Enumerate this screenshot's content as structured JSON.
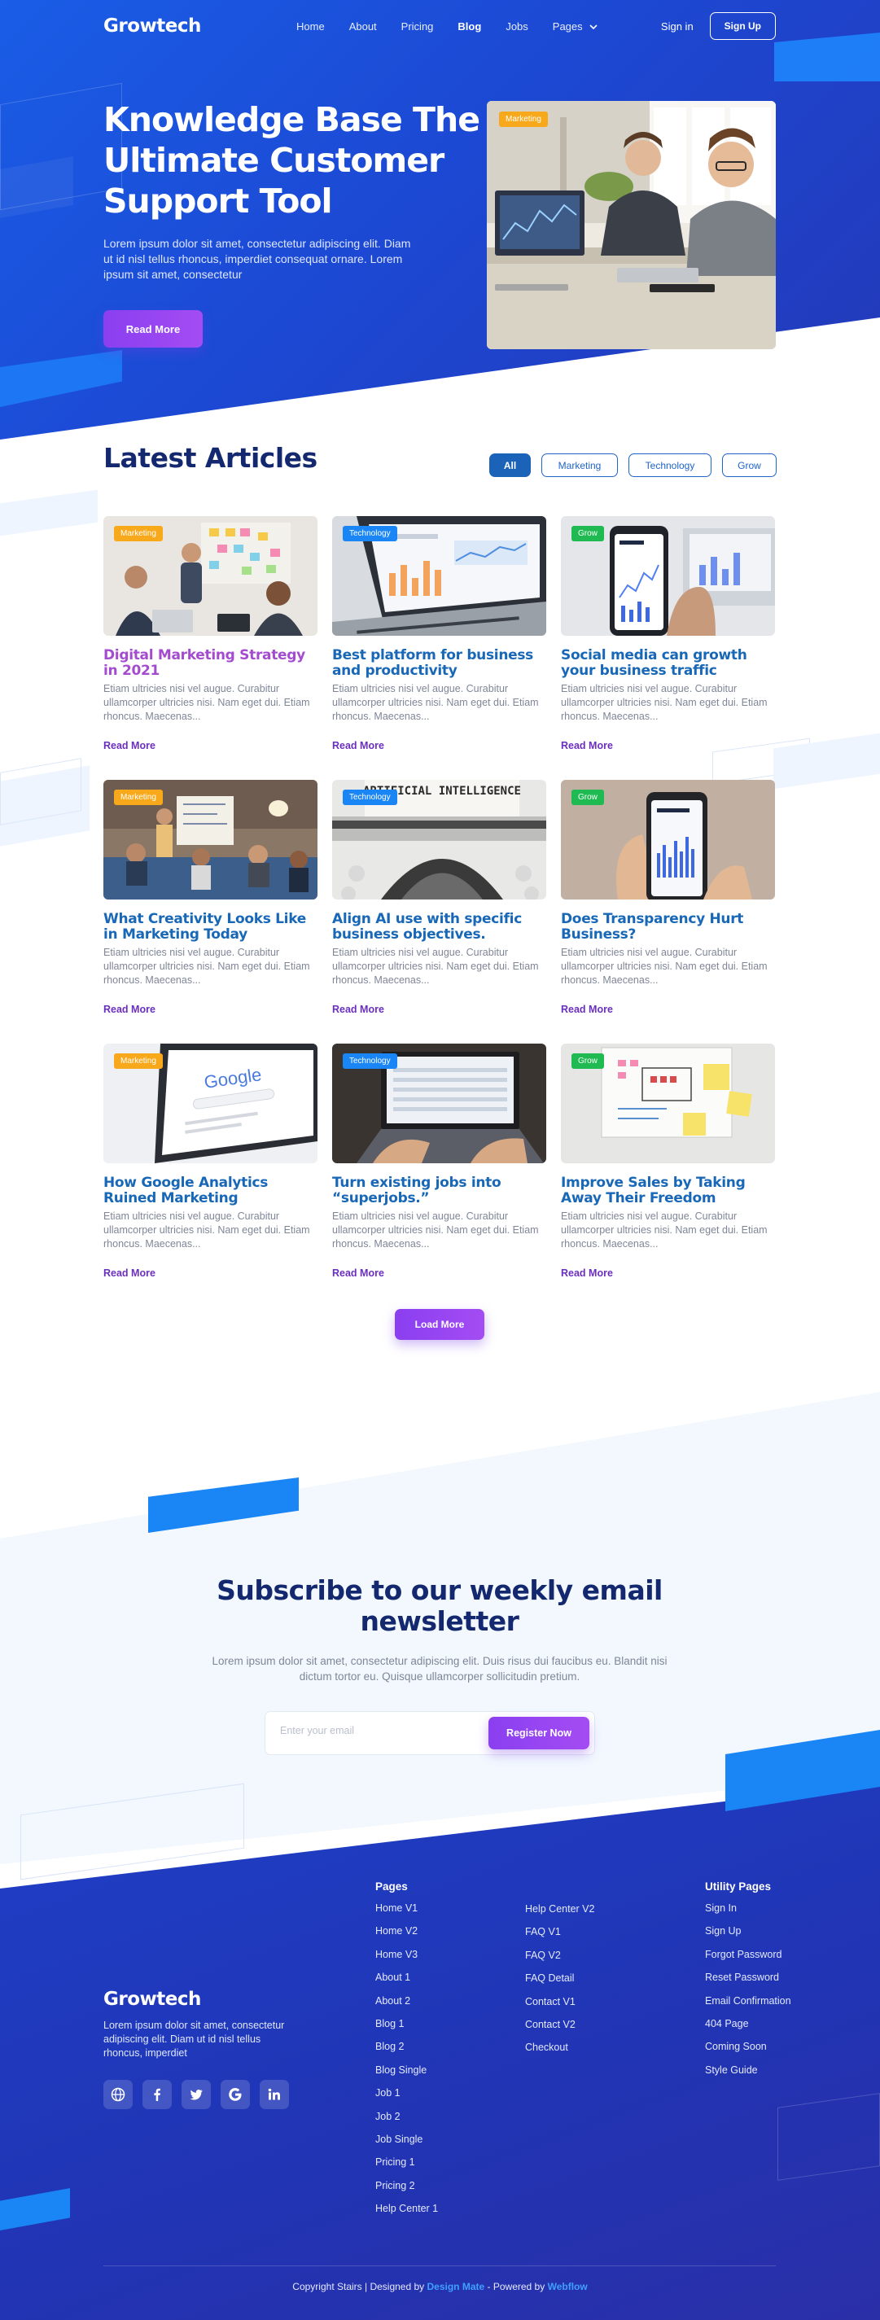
{
  "nav": {
    "logo": "Growtech",
    "links": [
      "Home",
      "About",
      "Pricing",
      "Blog",
      "Jobs",
      "Pages"
    ],
    "active": "Blog",
    "sign_in": "Sign in",
    "sign_up": "Sign Up"
  },
  "hero": {
    "title": "Knowledge Base The Ultimate Customer Support Tool",
    "text": "Lorem ipsum dolor sit amet, consectetur adipiscing elit. Diam ut id nisl tellus rhoncus, imperdiet consequat ornare. Lorem ipsum sit amet, consectetur",
    "button": "Read More",
    "image_badge": "Marketing"
  },
  "articles": {
    "title": "Latest Articles",
    "filters": [
      "All",
      "Marketing",
      "Technology",
      "Grow"
    ],
    "active_filter": "All",
    "read_more": "Read More",
    "load_more": "Load More",
    "cards": [
      {
        "category": "Marketing",
        "title": "Digital Marketing Strategy in 2021",
        "excerpt": "Etiam ultricies nisi vel augue. Curabitur ullamcorper ultricies nisi. Nam eget dui. Etiam rhoncus. Maecenas..."
      },
      {
        "category": "Technology",
        "title": "Best platform for business and productivity",
        "excerpt": "Etiam ultricies nisi vel augue. Curabitur ullamcorper ultricies nisi. Nam eget dui. Etiam rhoncus. Maecenas..."
      },
      {
        "category": "Grow",
        "title": "Social media can growth your business traffic",
        "excerpt": "Etiam ultricies nisi vel augue. Curabitur ullamcorper ultricies nisi. Nam eget dui. Etiam rhoncus. Maecenas..."
      },
      {
        "category": "Marketing",
        "title": "What Creativity Looks Like in Marketing Today",
        "excerpt": "Etiam ultricies nisi vel augue. Curabitur ullamcorper ultricies nisi. Nam eget dui. Etiam rhoncus. Maecenas..."
      },
      {
        "category": "Technology",
        "title": "Align AI use with specific business objectives.",
        "excerpt": "Etiam ultricies nisi vel augue. Curabitur ullamcorper ultricies nisi. Nam eget dui. Etiam rhoncus. Maecenas..."
      },
      {
        "category": "Grow",
        "title": "Does Transparency Hurt Business?",
        "excerpt": "Etiam ultricies nisi vel augue. Curabitur ullamcorper ultricies nisi. Nam eget dui. Etiam rhoncus. Maecenas..."
      },
      {
        "category": "Marketing",
        "title": "How Google Analytics Ruined Marketing",
        "excerpt": "Etiam ultricies nisi vel augue. Curabitur ullamcorper ultricies nisi. Nam eget dui. Etiam rhoncus. Maecenas..."
      },
      {
        "category": "Technology",
        "title": "Turn existing jobs into “superjobs.”",
        "excerpt": "Etiam ultricies nisi vel augue. Curabitur ullamcorper ultricies nisi. Nam eget dui. Etiam rhoncus. Maecenas..."
      },
      {
        "category": "Grow",
        "title": "Improve Sales by Taking Away Their Freedom",
        "excerpt": "Etiam ultricies nisi vel augue. Curabitur ullamcorper ultricies nisi. Nam eget dui. Etiam rhoncus. Maecenas..."
      }
    ],
    "image_texts": {
      "ai_typewriter": "ARTIFICIAL INTELLIGENCE",
      "google": "Google"
    }
  },
  "newsletter": {
    "title": "Subscribe to our weekly email newsletter",
    "text": "Lorem ipsum dolor sit amet, consectetur adipiscing elit. Duis risus dui faucibus eu. Blandit nisi dictum tortor eu. Quisque ullamcorper sollicitudin pretium.",
    "placeholder": "Enter your email",
    "button": "Register Now"
  },
  "footer": {
    "logo": "Growtech",
    "text": "Lorem ipsum dolor sit amet, consectetur adipiscing elit. Diam ut id nisl tellus rhoncus, imperdiet",
    "socials": [
      "globe-icon",
      "facebook-icon",
      "twitter-icon",
      "google-icon",
      "linkedin-icon"
    ],
    "pages_title": "Pages",
    "pages_col1": [
      "Home V1",
      "Home V2",
      "Home V3",
      "About 1",
      "About 2",
      "Blog 1",
      "Blog 2",
      "Blog Single",
      "Job 1",
      "Job 2",
      "Job Single",
      "Pricing 1",
      "Pricing 2",
      "Help Center 1"
    ],
    "pages_col2": [
      "Help Center V2",
      "FAQ V1",
      "FAQ V2",
      "FAQ Detail",
      "Contact V1",
      "Contact V2",
      "Checkout"
    ],
    "utility_title": "Utility Pages",
    "utility": [
      "Sign In",
      "Sign Up",
      "Forgot Password",
      "Reset Password",
      "Email Confirmation",
      "404 Page",
      "Coming Soon",
      "Style Guide"
    ],
    "copyright_prefix": "Copyright Stairs | Designed by",
    "designer": "Design Mate",
    "powered_prefix": "- Powered by",
    "powered": "Webflow"
  },
  "colors": {
    "primary_blue": "#1c49d4",
    "accent_blue": "#1a86f5",
    "purple": "#9a45f2",
    "navy_text": "#13286e",
    "marketing": "#f7a91b",
    "technology": "#1a86f5",
    "grow": "#1fba52"
  }
}
